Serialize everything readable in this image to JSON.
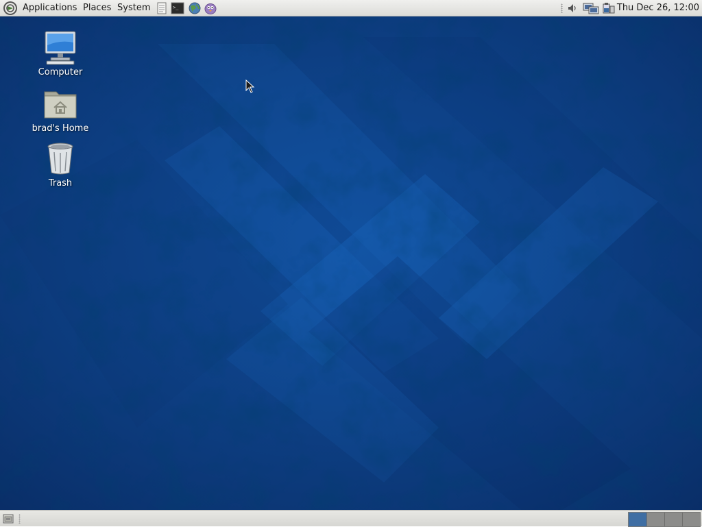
{
  "top_panel": {
    "menus": [
      {
        "label": "Applications"
      },
      {
        "label": "Places"
      },
      {
        "label": "System"
      }
    ],
    "launchers": [
      "text-editor-icon",
      "terminal-icon",
      "web-browser-icon",
      "pidgin-icon"
    ],
    "tray": [
      "volume-icon",
      "network-icon",
      "battery-icon"
    ],
    "clock": "Thu Dec 26, 12:00"
  },
  "desktop": {
    "icons": [
      {
        "label": "Computer",
        "icon": "computer-icon"
      },
      {
        "label": "brad's Home",
        "icon": "home-folder-icon"
      },
      {
        "label": "Trash",
        "icon": "trash-icon"
      }
    ],
    "background_color": "#0d3f85"
  },
  "bottom_panel": {
    "workspaces": 4,
    "active_workspace": 1
  }
}
